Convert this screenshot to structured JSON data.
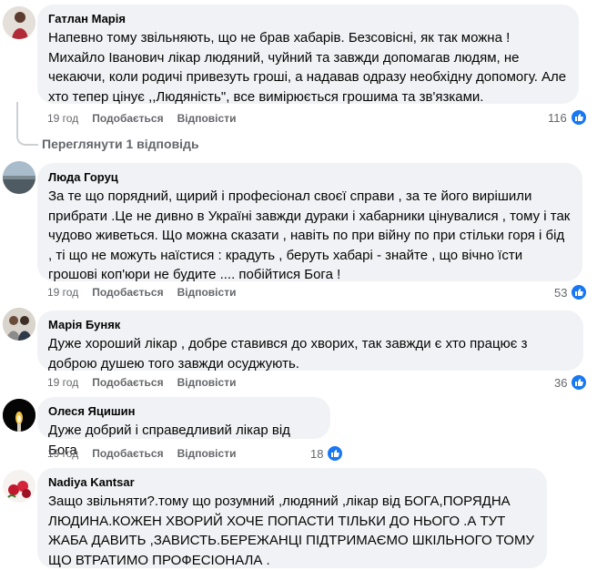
{
  "comments": [
    {
      "author": "Гатлан Марія",
      "text": "Напевно тому звільняють, що не брав хабарів. Безсовісні, як так можна ! Михайло Іванович лікар людяний, чуйний та завжди допомагав людям, не чекаючи, коли родичі привезуть гроші, а надавав одразу необхідну допомогу. Але хто тепер цінує ,,Людяність\", все вимірюється грошима та зв'язками.",
      "time": "19 год",
      "like": "Подобається",
      "reply": "Відповісти",
      "reaction_count": "116"
    },
    {
      "author": "Люда Горуц",
      "text": "За те що порядний, щирий і професіонал своєї справи , за те його вирішили прибрати .Це не дивно в Україні завжди дураки і хабарники цінувалися , тому і так чудово живеться. Що можна сказати , навіть по при війну по при стільки горя і бід , ті що не можуть наїстися : крадуть , беруть хабарі - знайте , що вічно їсти грошові коп'юри не будите .... побійтися Бога !",
      "time": "19 год",
      "like": "Подобається",
      "reply": "Відповісти",
      "reaction_count": "53"
    },
    {
      "author": "Марія Буняк",
      "text": "Дуже хороший лікар , добре ставився до хворих, так завжди є хто працює з доброю душею того завжди осуджують.",
      "time": "19 год",
      "like": "Подобається",
      "reply": "Відповісти",
      "reaction_count": "36"
    },
    {
      "author": "Олеся Яцишин",
      "text": "Дуже добрий і справедливий лікар від Бога",
      "time": "19 год",
      "like": "Подобається",
      "reply": "Відповісти",
      "reaction_count": "18"
    },
    {
      "author": "Nadiya Kantsar",
      "text": "Защо звільняти?.тому що розумний ,людяний ,лікар від БОГА,ПОРЯДНА ЛЮДИНА.КОЖЕН ХВОРИЙ ХОЧЕ ПОПАСТИ ТІЛЬКИ ДО НЬОГО .А ТУТ ЖАБА ДАВИТЬ ,ЗАВИСТЬ.БЕРЕЖАНЦІ ПІДТРИМАЄМО ШКІЛЬНОГО ТОМУ ЩО ВТРАТИМО ПРОФЕСІОНАЛА ."
    }
  ],
  "view_replies": "Переглянути 1 відповідь",
  "colors": {
    "bubble": "#f0f2f5",
    "like_blue": "#1877f2",
    "meta_gray": "#65676b"
  },
  "icons": {
    "reaction": "thumbs-up-icon"
  }
}
